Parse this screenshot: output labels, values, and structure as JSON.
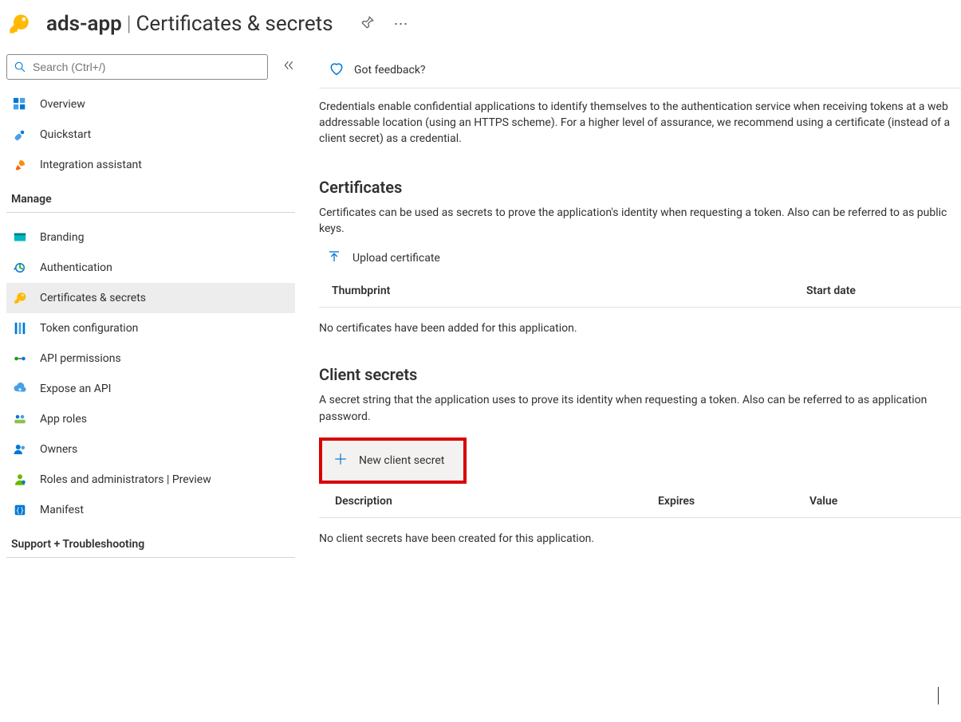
{
  "header": {
    "app_name": "ads-app",
    "page_title": "Certificates & secrets"
  },
  "search": {
    "placeholder": "Search (Ctrl+/)"
  },
  "sidebar": {
    "top": [
      {
        "label": "Overview",
        "icon": "overview"
      },
      {
        "label": "Quickstart",
        "icon": "quickstart"
      },
      {
        "label": "Integration assistant",
        "icon": "rocket"
      }
    ],
    "manage_label": "Manage",
    "manage": [
      {
        "label": "Branding",
        "icon": "branding"
      },
      {
        "label": "Authentication",
        "icon": "auth"
      },
      {
        "label": "Certificates & secrets",
        "icon": "key",
        "active": true
      },
      {
        "label": "Token configuration",
        "icon": "token"
      },
      {
        "label": "API permissions",
        "icon": "apiperm"
      },
      {
        "label": "Expose an API",
        "icon": "expose"
      },
      {
        "label": "App roles",
        "icon": "approles"
      },
      {
        "label": "Owners",
        "icon": "owners"
      },
      {
        "label": "Roles and administrators | Preview",
        "icon": "roles"
      },
      {
        "label": "Manifest",
        "icon": "manifest"
      }
    ],
    "support_label": "Support + Troubleshooting"
  },
  "toolbar": {
    "feedback": "Got feedback?"
  },
  "intro": "Credentials enable confidential applications to identify themselves to the authentication service when receiving tokens at a web addressable location (using an HTTPS scheme). For a higher level of assurance, we recommend using a certificate (instead of a client secret) as a credential.",
  "certs": {
    "title": "Certificates",
    "desc": "Certificates can be used as secrets to prove the application's identity when requesting a token. Also can be referred to as public keys.",
    "upload": "Upload certificate",
    "col_thumb": "Thumbprint",
    "col_start": "Start date",
    "empty": "No certificates have been added for this application."
  },
  "secrets": {
    "title": "Client secrets",
    "desc": "A secret string that the application uses to prove its identity when requesting a token. Also can be referred to as application password.",
    "new": "New client secret",
    "col_desc": "Description",
    "col_exp": "Expires",
    "col_val": "Value",
    "empty": "No client secrets have been created for this application."
  }
}
